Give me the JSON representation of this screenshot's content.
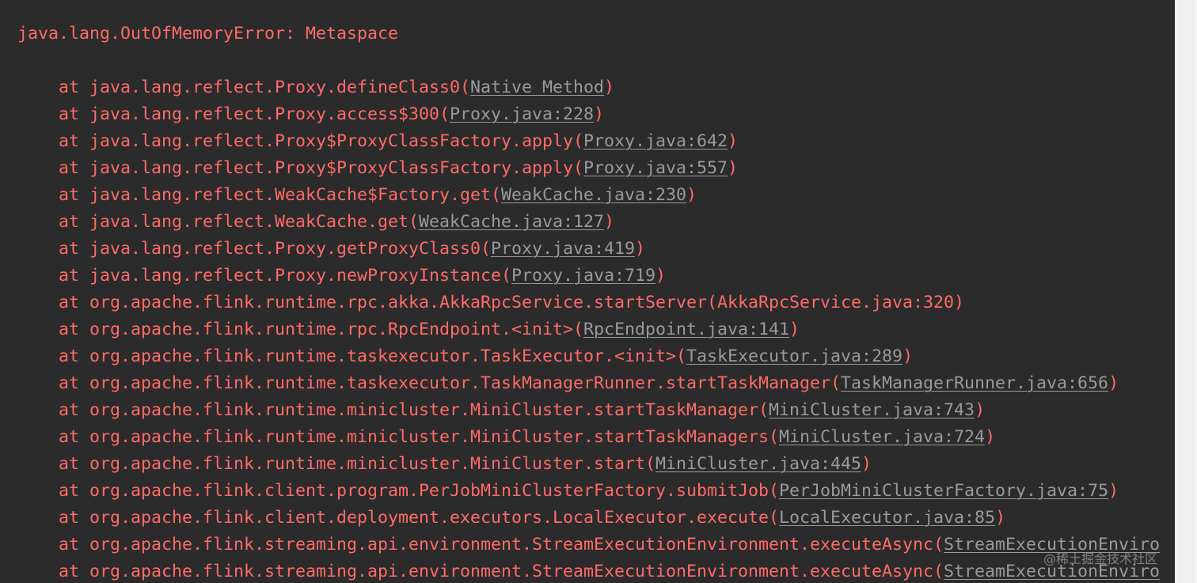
{
  "exception": "java.lang.OutOfMemoryError: Metaspace",
  "watermark": "@稀土掘金技术社区",
  "frames": [
    {
      "prefix": "at java.lang.reflect.Proxy.defineClass0(",
      "source": "Native Method",
      "suffix": ")"
    },
    {
      "prefix": "at java.lang.reflect.Proxy.access$300(",
      "source": "Proxy.java:228",
      "suffix": ")"
    },
    {
      "prefix": "at java.lang.reflect.Proxy$ProxyClassFactory.apply(",
      "source": "Proxy.java:642",
      "suffix": ")"
    },
    {
      "prefix": "at java.lang.reflect.Proxy$ProxyClassFactory.apply(",
      "source": "Proxy.java:557",
      "suffix": ")"
    },
    {
      "prefix": "at java.lang.reflect.WeakCache$Factory.get(",
      "source": "WeakCache.java:230",
      "suffix": ")"
    },
    {
      "prefix": "at java.lang.reflect.WeakCache.get(",
      "source": "WeakCache.java:127",
      "suffix": ")"
    },
    {
      "prefix": "at java.lang.reflect.Proxy.getProxyClass0(",
      "source": "Proxy.java:419",
      "suffix": ")"
    },
    {
      "prefix": "at java.lang.reflect.Proxy.newProxyInstance(",
      "source": "Proxy.java:719",
      "suffix": ")"
    },
    {
      "prefix": "at org.apache.flink.runtime.rpc.akka.AkkaRpcService.startServer(AkkaRpcService.java:320)",
      "source": "",
      "suffix": ""
    },
    {
      "prefix": "at org.apache.flink.runtime.rpc.RpcEndpoint.<init>(",
      "source": "RpcEndpoint.java:141",
      "suffix": ")"
    },
    {
      "prefix": "at org.apache.flink.runtime.taskexecutor.TaskExecutor.<init>(",
      "source": "TaskExecutor.java:289",
      "suffix": ")"
    },
    {
      "prefix": "at org.apache.flink.runtime.taskexecutor.TaskManagerRunner.startTaskManager(",
      "source": "TaskManagerRunner.java:656",
      "suffix": ")"
    },
    {
      "prefix": "at org.apache.flink.runtime.minicluster.MiniCluster.startTaskManager(",
      "source": "MiniCluster.java:743",
      "suffix": ")"
    },
    {
      "prefix": "at org.apache.flink.runtime.minicluster.MiniCluster.startTaskManagers(",
      "source": "MiniCluster.java:724",
      "suffix": ")"
    },
    {
      "prefix": "at org.apache.flink.runtime.minicluster.MiniCluster.start(",
      "source": "MiniCluster.java:445",
      "suffix": ")"
    },
    {
      "prefix": "at org.apache.flink.client.program.PerJobMiniClusterFactory.submitJob(",
      "source": "PerJobMiniClusterFactory.java:75",
      "suffix": ")"
    },
    {
      "prefix": "at org.apache.flink.client.deployment.executors.LocalExecutor.execute(",
      "source": "LocalExecutor.java:85",
      "suffix": ")"
    },
    {
      "prefix": "at org.apache.flink.streaming.api.environment.StreamExecutionEnvironment.executeAsync(",
      "source": "StreamExecutionEnviro",
      "suffix": ""
    },
    {
      "prefix": "at org.apache.flink.streaming.api.environment.StreamExecutionEnvironment.executeAsync(",
      "source": "StreamExecutionEnviro",
      "suffix": ""
    }
  ]
}
